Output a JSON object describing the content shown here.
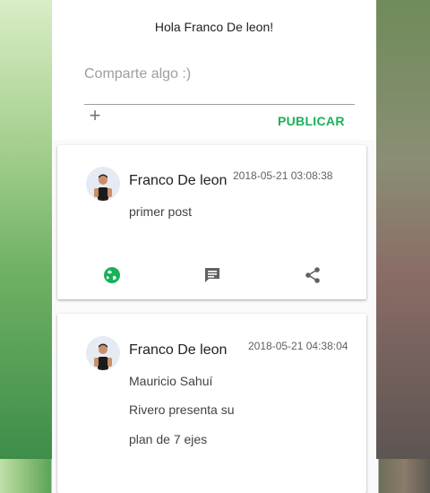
{
  "composer": {
    "greeting": "Hola Franco De leon!",
    "placeholder": "Comparte algo :)",
    "add_icon": "+",
    "publish_label": "PUBLICAR",
    "accent": "#1ab05a"
  },
  "posts": [
    {
      "author": "Franco De leon",
      "timestamp": "2018-05-21 03:08:38",
      "lines": [
        "primer post"
      ],
      "actions": [
        "globe-icon",
        "comment-icon",
        "share-icon"
      ]
    },
    {
      "author": "Franco De leon",
      "timestamp": "2018-05-21 04:38:04",
      "lines": [
        "Mauricio Sahuí",
        "Rivero presenta su",
        "plan de 7 ejes"
      ]
    }
  ]
}
